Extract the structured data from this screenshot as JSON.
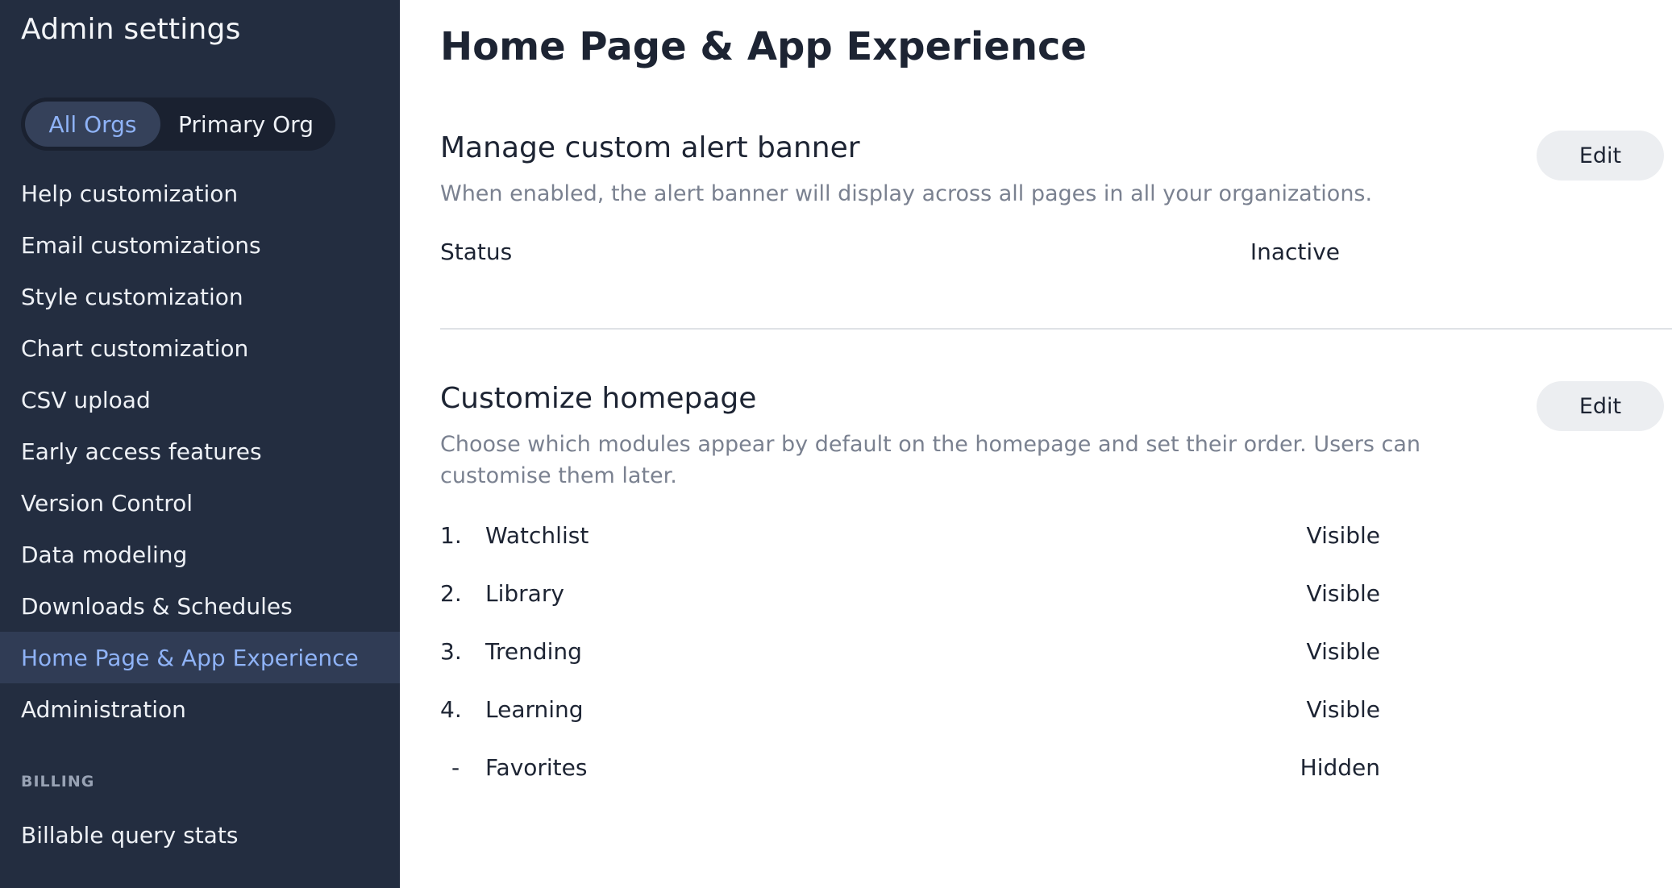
{
  "sidebar": {
    "title": "Admin settings",
    "org_toggle": {
      "all_orgs": "All Orgs",
      "primary_org": "Primary Org"
    },
    "items": [
      {
        "label": "Help customization"
      },
      {
        "label": "Email customizations"
      },
      {
        "label": "Style customization"
      },
      {
        "label": "Chart customization"
      },
      {
        "label": "CSV upload"
      },
      {
        "label": "Early access features"
      },
      {
        "label": "Version Control"
      },
      {
        "label": "Data modeling"
      },
      {
        "label": "Downloads & Schedules"
      },
      {
        "label": "Home Page & App Experience"
      },
      {
        "label": "Administration"
      }
    ],
    "billing_section": "BILLING",
    "billing_items": [
      {
        "label": "Billable query stats"
      }
    ]
  },
  "main": {
    "title": "Home Page & App Experience",
    "alert_banner": {
      "title": "Manage custom alert banner",
      "description": "When enabled, the alert banner will display across all pages in all your organizations.",
      "edit_label": "Edit",
      "status_label": "Status",
      "status_value": "Inactive"
    },
    "homepage": {
      "title": "Customize homepage",
      "description": "Choose which modules appear by default on the homepage and set their order. Users can customise them later.",
      "edit_label": "Edit",
      "modules": [
        {
          "index": "1.",
          "name": "Watchlist",
          "visibility": "Visible"
        },
        {
          "index": "2.",
          "name": "Library",
          "visibility": "Visible"
        },
        {
          "index": "3.",
          "name": "Trending",
          "visibility": "Visible"
        },
        {
          "index": "4.",
          "name": "Learning",
          "visibility": "Visible"
        },
        {
          "index": "-",
          "name": "Favorites",
          "visibility": "Hidden"
        }
      ]
    }
  },
  "colors": {
    "sidebar_bg": "#232d40",
    "accent": "#8fb3f7",
    "active_bg": "#303c55"
  }
}
